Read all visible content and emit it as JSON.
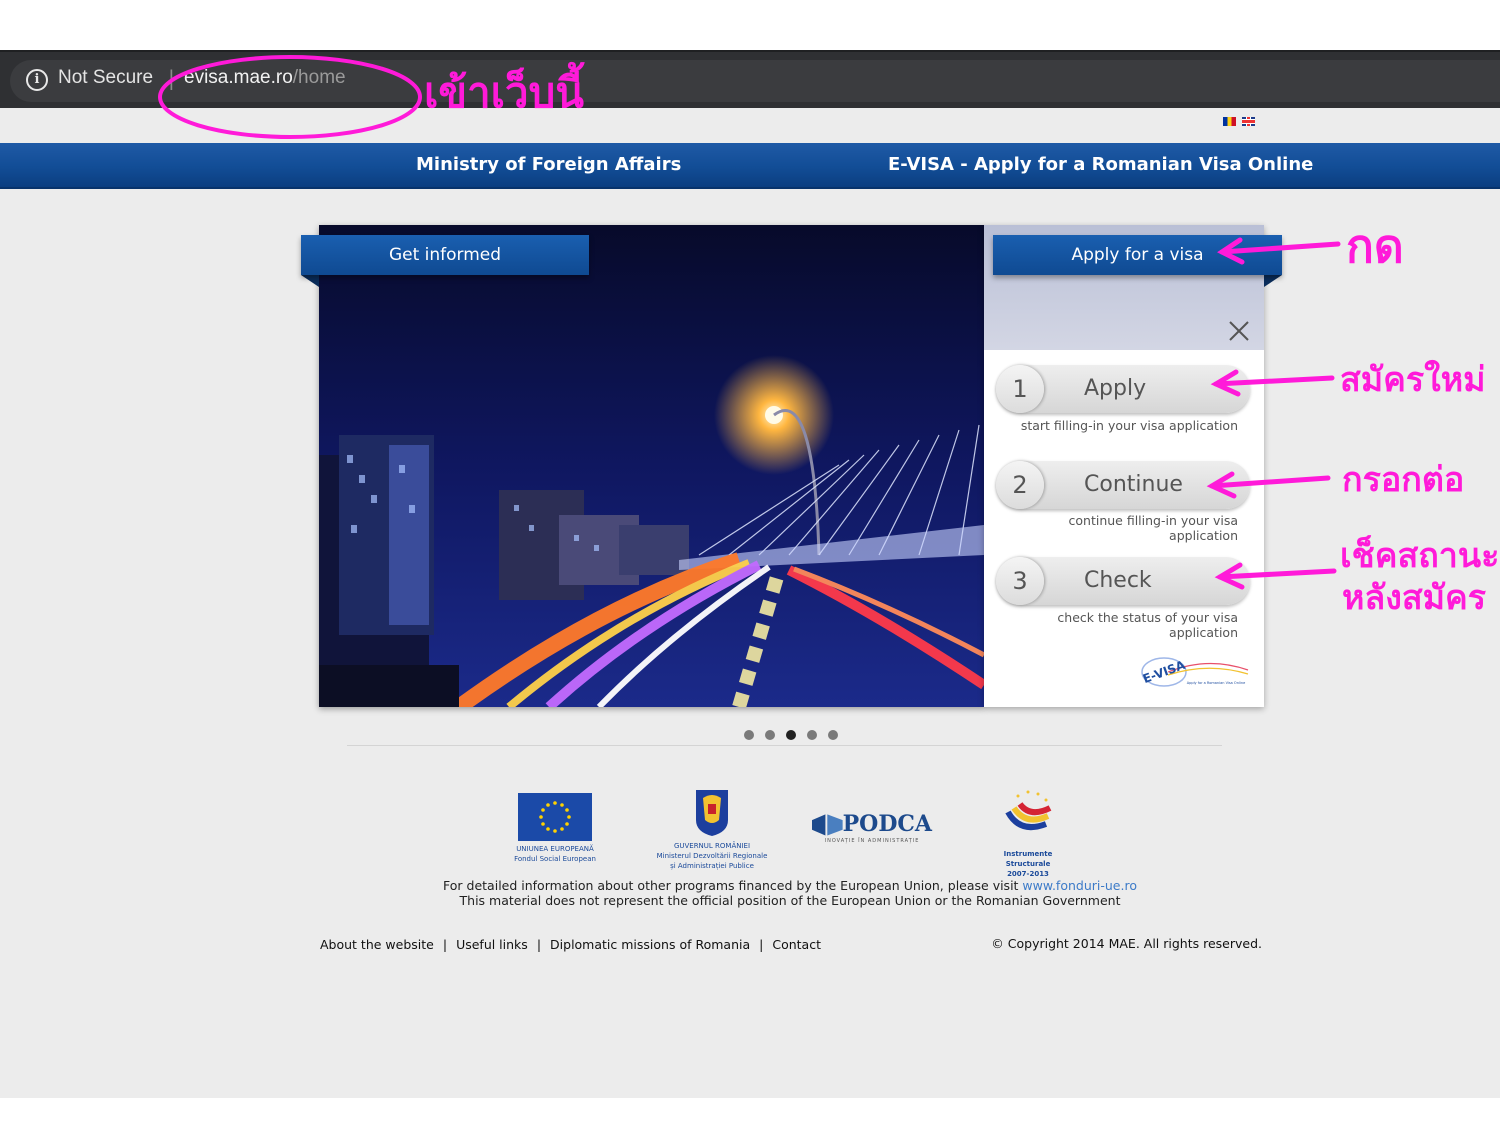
{
  "browser": {
    "security_label": "Not Secure",
    "url_host": "evisa.mae.ro",
    "url_path": "/home"
  },
  "header": {
    "left_title": "Ministry of Foreign Affairs",
    "right_title": "E-VISA - Apply for a Romanian Visa Online"
  },
  "hero": {
    "get_informed": "Get informed",
    "apply_for_visa": "Apply for a visa",
    "steps": [
      {
        "num": "1",
        "label": "Apply",
        "desc": "start filling-in your visa application"
      },
      {
        "num": "2",
        "label": "Continue",
        "desc": "continue filling-in your visa application"
      },
      {
        "num": "3",
        "label": "Check",
        "desc": "check the status of your visa application"
      }
    ],
    "evisa_logo_text": "E-VISA",
    "evisa_logo_sub": "Apply for a Romanian Visa Online",
    "slide_count": 5,
    "active_slide": 3
  },
  "logos": {
    "eu_line1": "UNIUNEA EUROPEANĂ",
    "eu_line2": "Fondul Social European",
    "gov_line1": "GUVERNUL ROMÂNIEI",
    "gov_line2": "Ministerul Dezvoltării Regionale",
    "gov_line3": "și Administrației Publice",
    "podca": "PODCA",
    "podca_sub": "INOVAȚIE ÎN ADMINISTRAȚIE",
    "instr_line1": "Instrumente Structurale",
    "instr_line2": "2007-2013"
  },
  "footer": {
    "info_prefix": "For detailed information about other programs financed by the European Union, please visit ",
    "info_link": "www.fonduri-ue.ro",
    "disclaimer": "This material does not represent the official position of the European Union or the Romanian Government",
    "nav": [
      "About the website",
      "Useful links",
      "Diplomatic missions of Romania",
      "Contact"
    ],
    "nav_sep": "|",
    "copyright": "© Copyright 2014 MAE. All rights reserved."
  },
  "annotations": {
    "visit_site": "เข้าเว็บนี้",
    "press": "กด",
    "new_apply": "สมัครใหม่",
    "continue_fill": "กรอกต่อ",
    "check_status_1": "เช็คสถานะ",
    "check_status_2": "หลังสมัคร"
  },
  "colors": {
    "brand_blue": "#124d96",
    "annotation_pink": "#ff1ad9"
  }
}
